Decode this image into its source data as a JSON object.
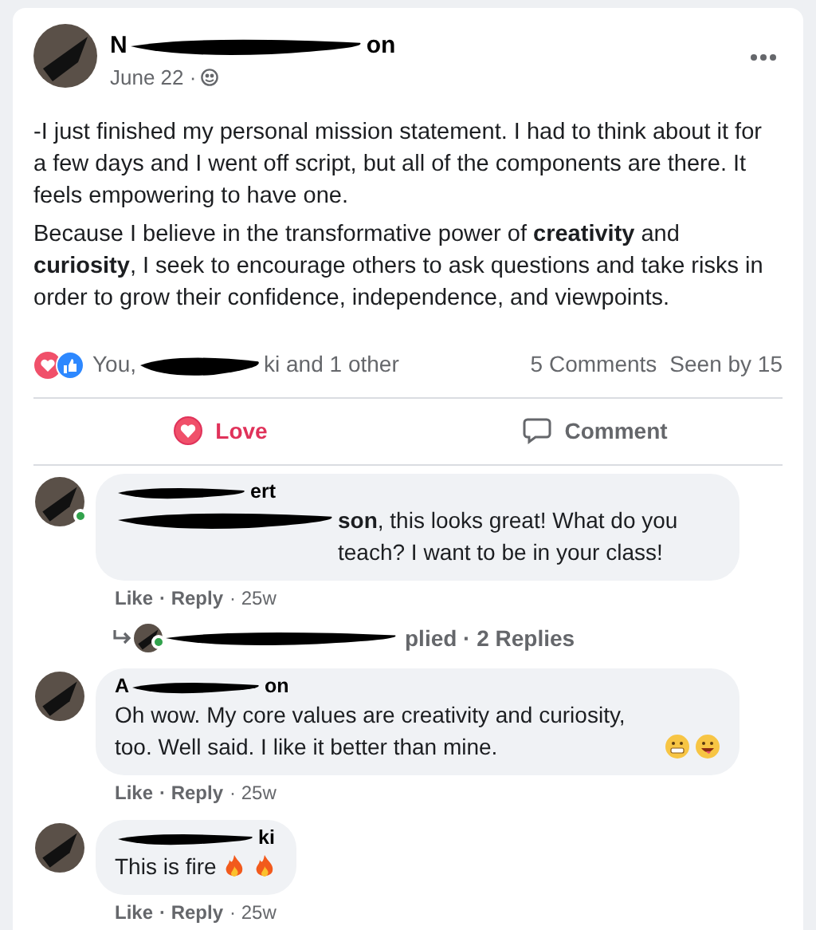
{
  "post": {
    "author": {
      "name_start": "N",
      "name_end": "on"
    },
    "date": "June 22 ·",
    "paragraphs": [
      "-I just finished my personal mission statement. I had to think about it for a few days and I went off script, but all of the components are there. It feels empowering to have one.",
      "Because I believe in the transformative power of **creativity** and **curiosity**, I seek to encourage others to ask questions and take risks in order to grow their confidence, independence, and viewpoints."
    ],
    "reactions": {
      "prefix": "You,",
      "suffix": "ki and 1 other"
    },
    "comments_count": "5 Comments",
    "seen": "Seen by 15",
    "actions": [
      {
        "kind": "love",
        "label": "Love",
        "selected": true
      },
      {
        "kind": "comment",
        "label": "Comment",
        "selected": false
      }
    ]
  },
  "comments": [
    {
      "name_end": "ert",
      "online": true,
      "text": "**son**, this looks great! What do you teach? I want to be in your class!",
      "like": "Like",
      "reply": "· Reply",
      "time": "· 25w",
      "replies": "plied · 2 Replies"
    },
    {
      "name_start": "A",
      "name_end": "on",
      "online": false,
      "text": "Oh wow. My core values are creativity and curiosity, too. Well said. I like it better than mine.",
      "emoji": [
        {
          "kind": "grimace"
        },
        {
          "kind": "grin"
        }
      ],
      "like": "Like",
      "reply": "· Reply",
      "time": "· 25w"
    },
    {
      "name_end": "ki",
      "online": false,
      "text": "This is fire",
      "emoji": [
        {
          "kind": "fire"
        },
        {
          "kind": "fire"
        }
      ],
      "like": "Like",
      "reply": "· Reply",
      "time": "· 25w"
    }
  ]
}
